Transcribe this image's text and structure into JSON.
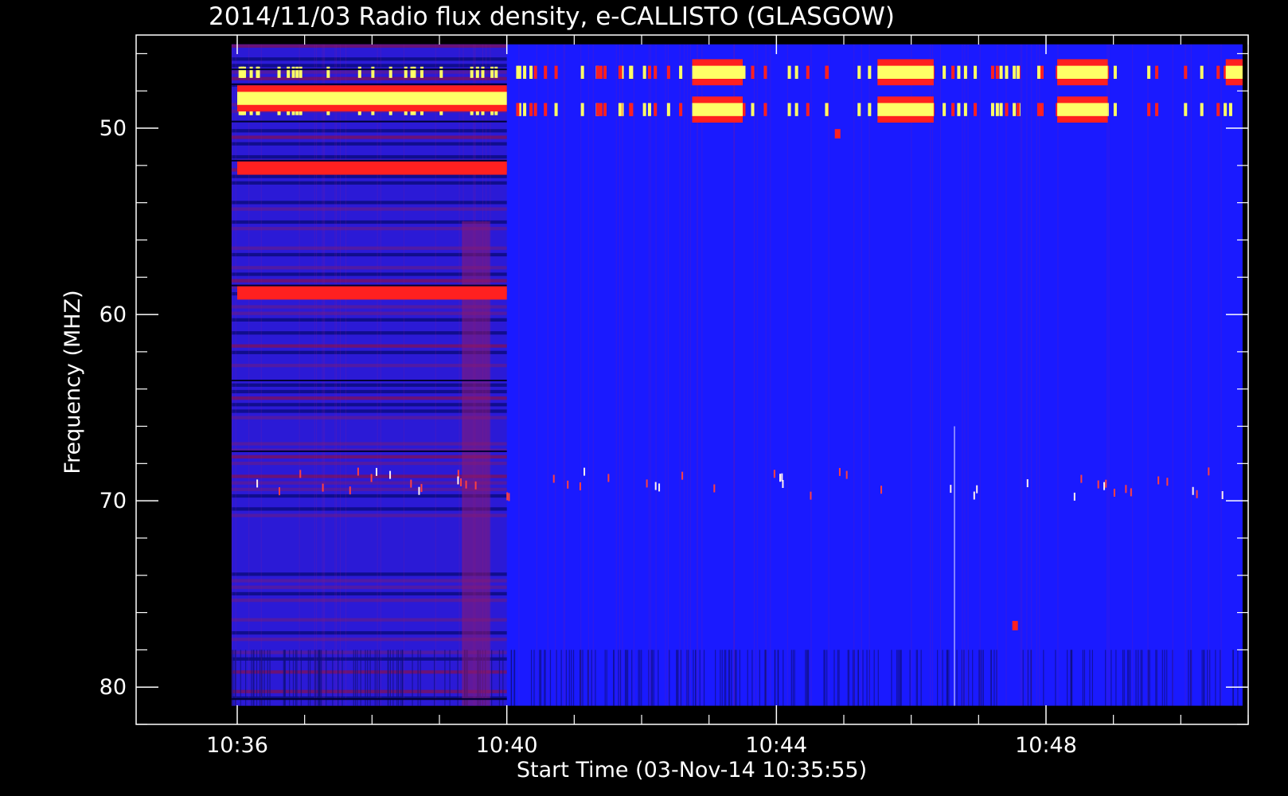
{
  "chart_data": {
    "type": "heatmap",
    "title": "2014/11/03  Radio flux density, e-CALLISTO (GLASGOW)",
    "xlabel": "Start Time (03-Nov-14 10:35:55)",
    "ylabel": "Frequency (MHZ)",
    "x_ticks": [
      "10:36",
      "10:40",
      "10:44",
      "10:48"
    ],
    "y_ticks": [
      "50",
      "60",
      "70",
      "80"
    ],
    "xlim_minutes_after_1035": [
      -0.5,
      16.0
    ],
    "ylim_mhz": [
      45.0,
      82.0
    ],
    "data_time_range": [
      "10:35:55",
      "10:50:55"
    ],
    "data_freq_range_mhz": [
      45.5,
      81.0
    ],
    "y_axis_inverted": true,
    "colormap": [
      "#000000",
      "#1010ff",
      "#ff0000",
      "#ffff66"
    ],
    "background_color": "#1a1aff",
    "features": [
      {
        "kind": "band",
        "freq_mhz": 48.4,
        "from": "10:36:00",
        "to": "10:40:00",
        "level": "high"
      },
      {
        "kind": "band",
        "freq_mhz": 52.1,
        "from": "10:36:00",
        "to": "10:40:00",
        "level": "medium"
      },
      {
        "kind": "band",
        "freq_mhz": 58.8,
        "from": "10:36:00",
        "to": "10:40:00",
        "level": "medium"
      },
      {
        "kind": "band",
        "freq_mhz": 47.0,
        "from": "10:42:45",
        "to": "10:43:30",
        "level": "high"
      },
      {
        "kind": "band",
        "freq_mhz": 49.0,
        "from": "10:42:45",
        "to": "10:43:30",
        "level": "high"
      },
      {
        "kind": "band",
        "freq_mhz": 47.0,
        "from": "10:45:30",
        "to": "10:46:20",
        "level": "high"
      },
      {
        "kind": "band",
        "freq_mhz": 49.0,
        "from": "10:45:30",
        "to": "10:46:20",
        "level": "high"
      },
      {
        "kind": "band",
        "freq_mhz": 47.0,
        "from": "10:48:10",
        "to": "10:48:55",
        "level": "high"
      },
      {
        "kind": "band",
        "freq_mhz": 49.0,
        "from": "10:48:10",
        "to": "10:48:55",
        "level": "high"
      },
      {
        "kind": "band",
        "freq_mhz": 47.0,
        "from": "10:50:40",
        "to": "10:50:55",
        "level": "high"
      },
      {
        "kind": "spot",
        "freq_mhz": 50.3,
        "time": "10:44:52",
        "level": "medium"
      },
      {
        "kind": "spot",
        "freq_mhz": 76.7,
        "time": "10:47:30",
        "level": "medium"
      }
    ]
  }
}
